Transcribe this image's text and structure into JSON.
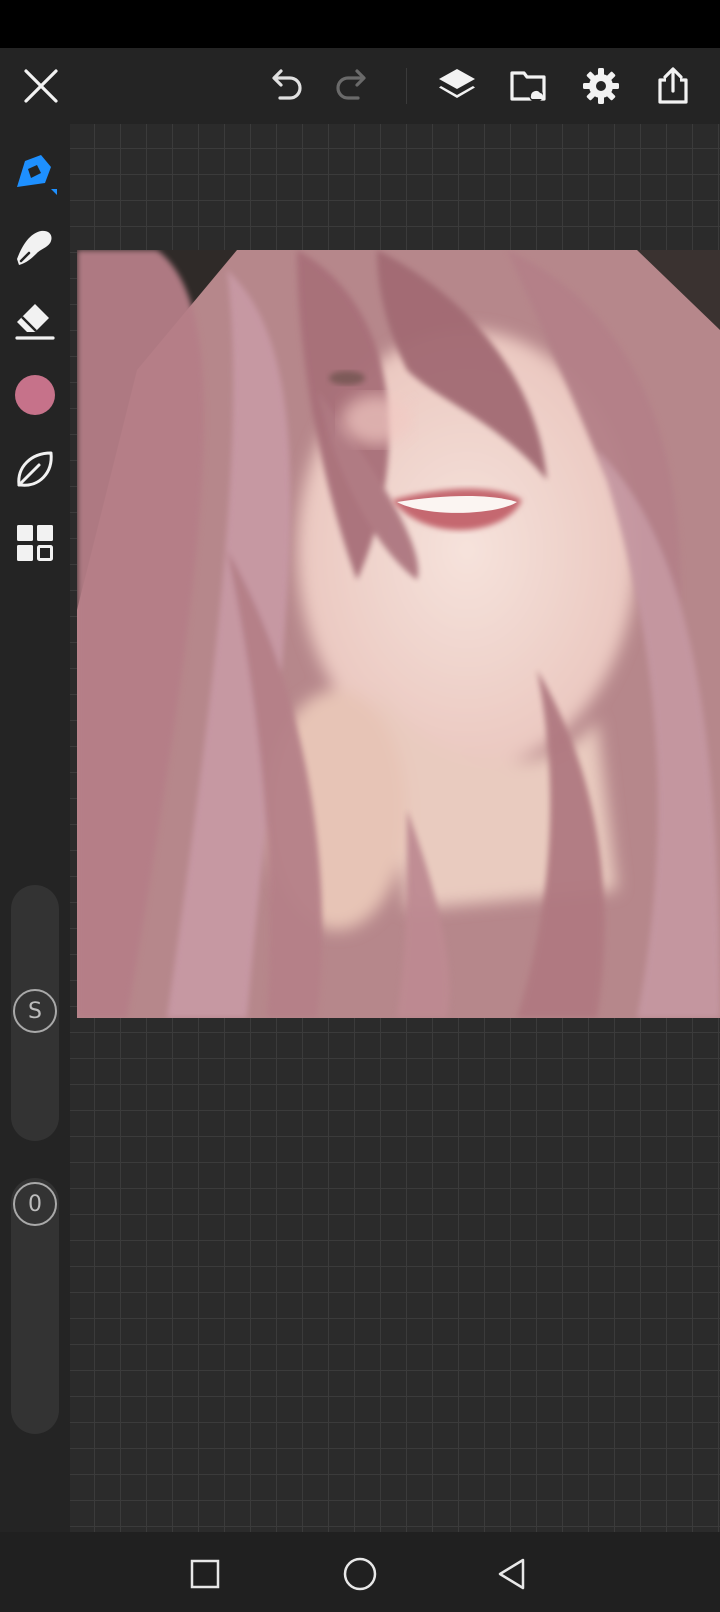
{
  "app": {
    "canvas_background": "#2b2b2b",
    "toolbar_background": "#242424",
    "accent": "#1e90ff"
  },
  "top_bar": {
    "close": {
      "icon": "close-icon"
    },
    "undo": {
      "icon": "undo-icon"
    },
    "redo": {
      "icon": "redo-icon",
      "enabled": false
    },
    "layers": {
      "icon": "layers-icon"
    },
    "gallery": {
      "icon": "gallery-folder-icon"
    },
    "settings": {
      "icon": "gear-icon"
    },
    "share": {
      "icon": "share-icon"
    }
  },
  "tools": [
    {
      "name": "brush",
      "icon": "brush-icon",
      "selected": true
    },
    {
      "name": "smudge",
      "icon": "smudge-icon"
    },
    {
      "name": "eraser",
      "icon": "eraser-icon"
    },
    {
      "name": "color",
      "icon": "color-swatch",
      "color": "#c6728a"
    },
    {
      "name": "brush-library",
      "icon": "leaf-icon"
    },
    {
      "name": "adjustments",
      "icon": "grid-icon"
    }
  ],
  "sliders": {
    "size": {
      "label": "S"
    },
    "opacity": {
      "label": "0"
    }
  },
  "nav_bar": [
    {
      "name": "recents",
      "icon": "square-icon"
    },
    {
      "name": "home",
      "icon": "circle-icon"
    },
    {
      "name": "back",
      "icon": "triangle-back-icon"
    }
  ],
  "artwork": {
    "description_icon": "painting-image"
  }
}
